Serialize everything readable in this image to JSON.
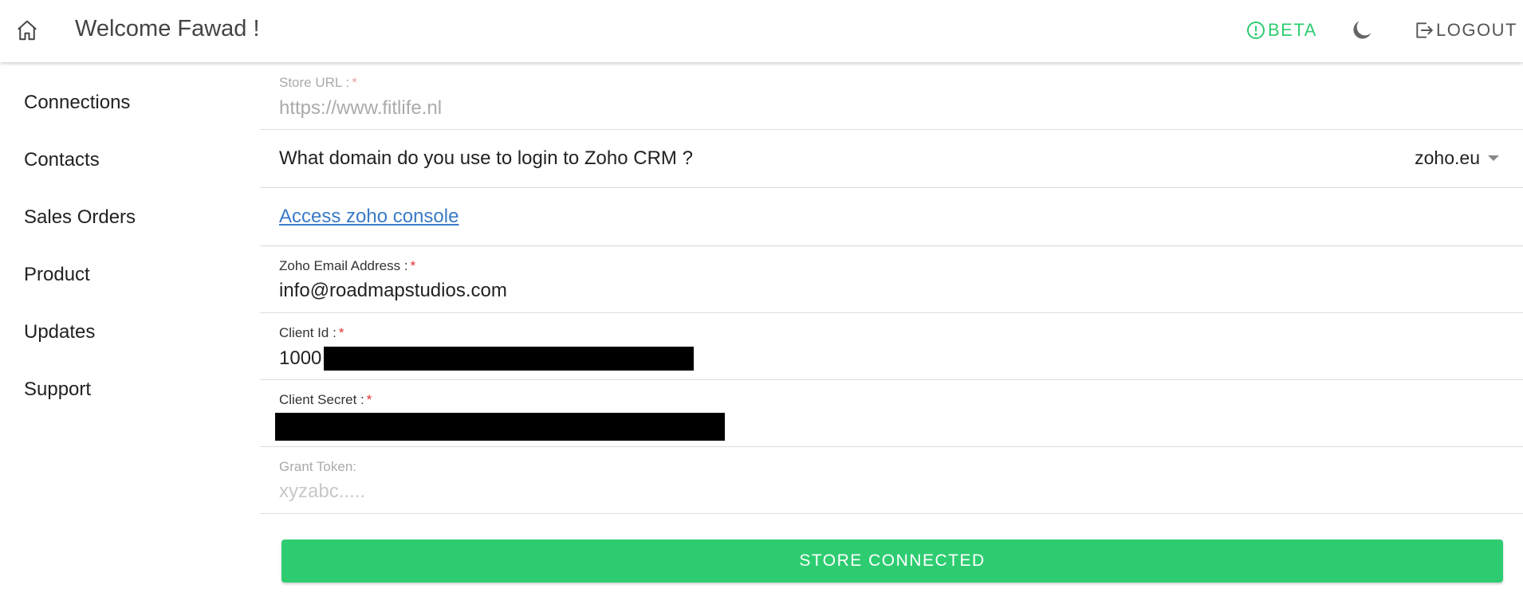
{
  "header": {
    "home_icon": "home-icon",
    "welcome_text": "Welcome Fawad !",
    "beta_icon": "info-circle-icon",
    "beta_label": "BETA",
    "theme_icon": "moon-icon",
    "logout_icon": "logout-icon",
    "logout_label": "LOGOUT"
  },
  "sidebar": {
    "items": [
      {
        "label": "Connections"
      },
      {
        "label": "Contacts"
      },
      {
        "label": "Sales Orders"
      },
      {
        "label": "Product"
      },
      {
        "label": "Updates"
      },
      {
        "label": "Support"
      }
    ]
  },
  "form": {
    "store_url": {
      "label": "Store URL :",
      "required_mark": "*",
      "value": "https://www.fitlife.nl"
    },
    "domain_question": "What domain do you use to login to Zoho CRM ?",
    "domain_selected": "zoho.eu",
    "console_link": "Access zoho console",
    "email": {
      "label": "Zoho Email Address :",
      "required_mark": "*",
      "value": "info@roadmapstudios.com"
    },
    "client_id": {
      "label": "Client Id :",
      "required_mark": "*",
      "value_visible": "1000"
    },
    "client_secret": {
      "label": "Client Secret :",
      "required_mark": "*"
    },
    "grant_token": {
      "label": "Grant Token:",
      "placeholder": "xyzabc....."
    }
  },
  "actions": {
    "store_button_label": "STORE CONNECTED"
  },
  "colors": {
    "accent_green": "#2ecc71",
    "link_blue": "#3a7bc8",
    "required_red": "#e03030"
  }
}
